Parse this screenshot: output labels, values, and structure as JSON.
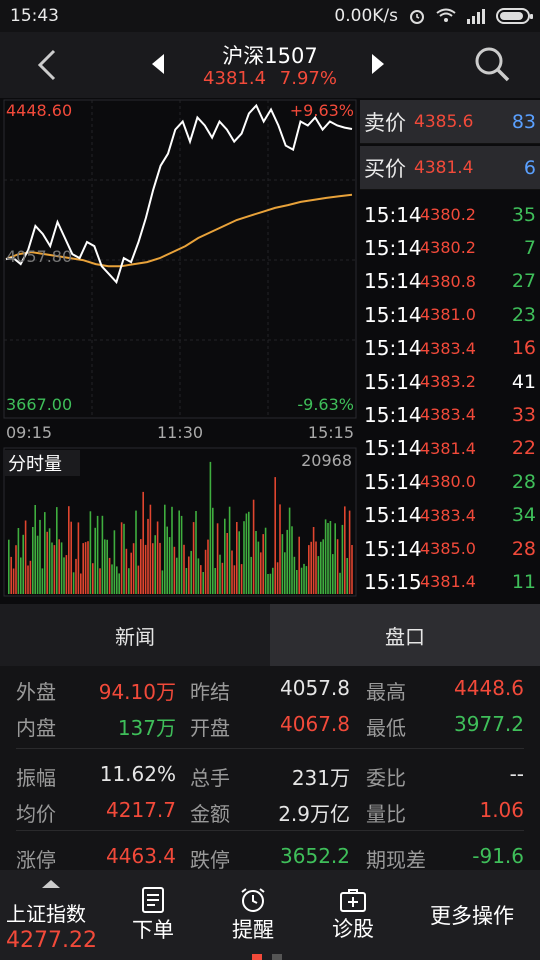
{
  "status_bar": {
    "time": "15:43",
    "network": "0.00K/s"
  },
  "header": {
    "title": "沪深1507",
    "price": "4381.4",
    "change_pct": "7.97%"
  },
  "chart": {
    "y_high": "4448.60",
    "y_mid": "4057.80",
    "y_low": "3667.00",
    "pct_high": "+9.63%",
    "pct_low": "-9.63%",
    "x_labels": [
      "09:15",
      "11:30",
      "15:15"
    ],
    "volume_label": "分时量",
    "volume_max": "20968"
  },
  "chart_data": {
    "type": "line",
    "series": [
      {
        "values": [
          4057.8,
          4060,
          4045,
          4080,
          4140,
          4120,
          4090,
          4150,
          4110,
          4070,
          4060,
          4100,
          4090,
          4040,
          4020,
          4000,
          4060,
          4050,
          4100,
          4160,
          4230,
          4290,
          4320,
          4380,
          4400,
          4350,
          4410,
          4390,
          4360,
          4400,
          4380,
          4350,
          4370,
          4420,
          4440,
          4400,
          4430,
          4390,
          4340,
          4330,
          4400,
          4390,
          4410,
          4380,
          4400,
          4390,
          4385,
          4381.4
        ]
      },
      {
        "values": [
          4057.8,
          4070,
          4075,
          4070,
          4065,
          4060,
          4055,
          4045,
          4040,
          4040,
          4045,
          4050,
          4060,
          4075,
          4090,
          4110,
          4125,
          4140,
          4155,
          4165,
          4175,
          4185,
          4192,
          4200,
          4205,
          4210,
          4214,
          4217.7
        ]
      }
    ],
    "ylim": [
      3667.0,
      4448.6
    ]
  },
  "order_book": {
    "ask": {
      "label": "卖价",
      "price": "4385.6",
      "volume": "83"
    },
    "bid": {
      "label": "买价",
      "price": "4381.4",
      "volume": "6"
    },
    "ticks": [
      {
        "time": "15:14",
        "price": "4380.2",
        "vol": "35",
        "color": "#3fbf5a"
      },
      {
        "time": "15:14",
        "price": "4380.2",
        "vol": "7",
        "color": "#3fbf5a"
      },
      {
        "time": "15:14",
        "price": "4380.8",
        "vol": "27",
        "color": "#3fbf5a"
      },
      {
        "time": "15:14",
        "price": "4381.0",
        "vol": "23",
        "color": "#3fbf5a"
      },
      {
        "time": "15:14",
        "price": "4383.4",
        "vol": "16",
        "color": "#f24a3a"
      },
      {
        "time": "15:14",
        "price": "4383.2",
        "vol": "41",
        "color": "#ffffff"
      },
      {
        "time": "15:14",
        "price": "4383.4",
        "vol": "33",
        "color": "#f24a3a"
      },
      {
        "time": "15:14",
        "price": "4381.4",
        "vol": "22",
        "color": "#f24a3a"
      },
      {
        "time": "15:14",
        "price": "4380.0",
        "vol": "28",
        "color": "#3fbf5a"
      },
      {
        "time": "15:14",
        "price": "4383.4",
        "vol": "34",
        "color": "#3fbf5a"
      },
      {
        "time": "15:14",
        "price": "4385.0",
        "vol": "28",
        "color": "#f24a3a"
      },
      {
        "time": "15:15",
        "price": "4381.4",
        "vol": "11",
        "color": "#3fbf5a"
      }
    ]
  },
  "tabs": [
    "新闻",
    "盘口"
  ],
  "stats": {
    "rows": [
      [
        {
          "l": "外盘",
          "v": "94.10万",
          "c": "#f24a3a"
        },
        {
          "l": "昨结",
          "v": "4057.8",
          "c": "#e6e6e6"
        },
        {
          "l": "最高",
          "v": "4448.6",
          "c": "#f24a3a"
        }
      ],
      [
        {
          "l": "内盘",
          "v": "137万",
          "c": "#3fbf5a"
        },
        {
          "l": "开盘",
          "v": "4067.8",
          "c": "#f24a3a"
        },
        {
          "l": "最低",
          "v": "3977.2",
          "c": "#3fbf5a"
        }
      ],
      [
        {
          "l": "振幅",
          "v": "11.62%",
          "c": "#e6e6e6"
        },
        {
          "l": "总手",
          "v": "231万",
          "c": "#e6e6e6"
        },
        {
          "l": "委比",
          "v": "--",
          "c": "#e6e6e6"
        }
      ],
      [
        {
          "l": "均价",
          "v": "4217.7",
          "c": "#f24a3a"
        },
        {
          "l": "金额",
          "v": "2.9万亿",
          "c": "#e6e6e6"
        },
        {
          "l": "量比",
          "v": "1.06",
          "c": "#f24a3a"
        }
      ],
      [
        {
          "l": "涨停",
          "v": "4463.4",
          "c": "#f24a3a"
        },
        {
          "l": "跌停",
          "v": "3652.2",
          "c": "#3fbf5a"
        },
        {
          "l": "期现差",
          "v": "-91.6",
          "c": "#3fbf5a"
        }
      ]
    ]
  },
  "bottom_nav": {
    "index_label": "上证指数",
    "index_value": "4277.22",
    "order": "下单",
    "alert": "提醒",
    "diagnose": "诊股",
    "more": "更多操作"
  }
}
